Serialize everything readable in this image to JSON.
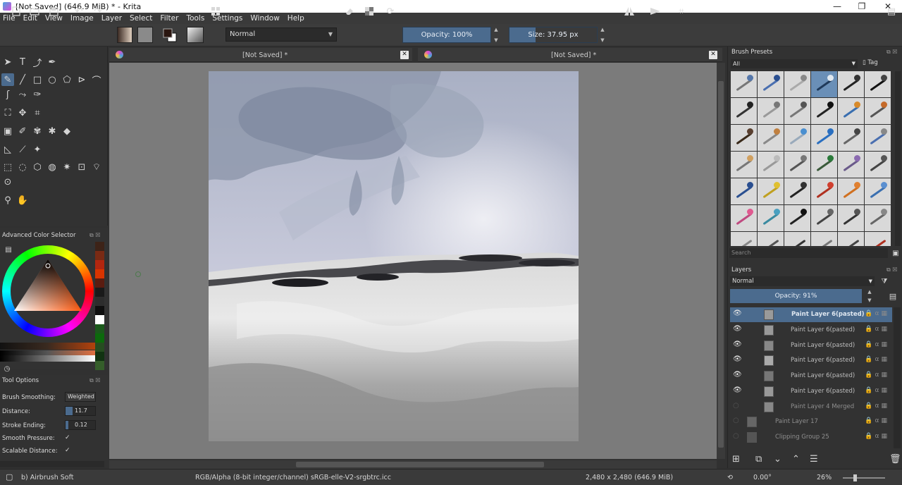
{
  "window": {
    "title": "[Not Saved]  (646.9 MiB)  * - Krita",
    "minimize": "—",
    "maximize": "❐",
    "close": "✕"
  },
  "menu": [
    "File",
    "Edit",
    "View",
    "Image",
    "Layer",
    "Select",
    "Filter",
    "Tools",
    "Settings",
    "Window",
    "Help"
  ],
  "toolbar": {
    "blend_mode": "Normal",
    "opacity": "Opacity: 100%",
    "size": "Size: 37.95 px"
  },
  "tabs": [
    {
      "label": "[Not Saved]  *"
    },
    {
      "label": "[Not Saved]  *"
    }
  ],
  "color_selector": {
    "title": "Advanced Color Selector"
  },
  "tool_options": {
    "title": "Tool Options",
    "brush_smoothing_label": "Brush Smoothing:",
    "brush_smoothing_value": "Weighted",
    "distance_label": "Distance:",
    "distance_value": "11.7",
    "stroke_ending_label": "Stroke Ending:",
    "stroke_ending_value": "0.12",
    "smooth_pressure_label": "Smooth Pressure:",
    "scalable_distance_label": "Scalable Distance:",
    "check": "✓"
  },
  "brush_presets": {
    "title": "Brush Presets",
    "filter": "All",
    "tag": "Tag",
    "search_placeholder": "Search"
  },
  "layers": {
    "title": "Layers",
    "blend_mode": "Normal",
    "opacity": "Opacity:  91%",
    "items": [
      {
        "name": "Paint Layer 6(pasted)",
        "visible": true,
        "selected": true
      },
      {
        "name": "Paint Layer 6(pasted)",
        "visible": true,
        "selected": false
      },
      {
        "name": "Paint Layer 6(pasted)",
        "visible": true,
        "selected": false
      },
      {
        "name": "Paint Layer 6(pasted)",
        "visible": true,
        "selected": false
      },
      {
        "name": "Paint Layer 6(pasted)",
        "visible": true,
        "selected": false
      },
      {
        "name": "Paint Layer 6(pasted)",
        "visible": true,
        "selected": false
      },
      {
        "name": "Paint Layer 4 Merged",
        "visible": false,
        "selected": false
      },
      {
        "name": "Paint Layer 17",
        "visible": false,
        "selected": false
      },
      {
        "name": "Clipping Group 25",
        "visible": false,
        "selected": false
      }
    ]
  },
  "status": {
    "brush": "b) Airbrush Soft",
    "color_space": "RGB/Alpha (8-bit integer/channel)  sRGB-elle-V2-srgbtrc.icc",
    "dimensions": "2,480 x 2,480 (646.9 MiB)",
    "rotation": "0.00°",
    "zoom": "26%"
  }
}
